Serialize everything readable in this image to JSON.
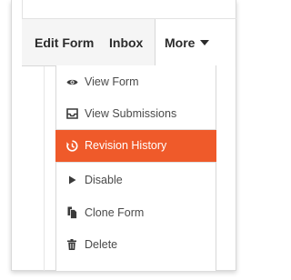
{
  "toolbar": {
    "edit_form_label": "Edit Form",
    "inbox_label": "Inbox",
    "more_label": "More"
  },
  "menu": {
    "items": [
      {
        "label": "View Form",
        "icon": "eye-icon"
      },
      {
        "label": "View Submissions",
        "icon": "inbox-tray-icon"
      },
      {
        "label": "Revision History",
        "icon": "history-clock-icon",
        "active": true
      },
      {
        "label": "Disable",
        "icon": "play-triangle-icon"
      },
      {
        "label": "Clone Form",
        "icon": "copy-documents-icon"
      },
      {
        "label": "Delete",
        "icon": "trash-icon"
      }
    ]
  },
  "colors": {
    "active_item_bg": "#ef5a2a",
    "toolbar_bg": "#f5f5f5",
    "text": "#2b2b2b",
    "menu_text": "#4a4a4a"
  }
}
